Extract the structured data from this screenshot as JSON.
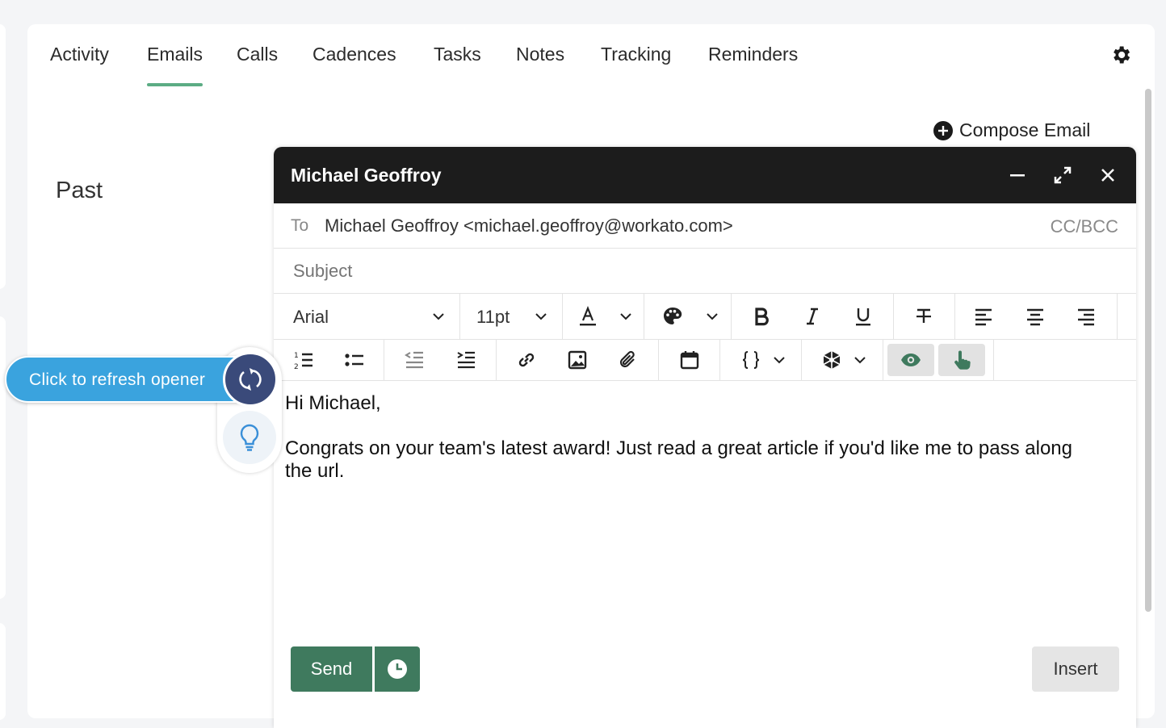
{
  "tabs": [
    {
      "label": "Activity"
    },
    {
      "label": "Emails"
    },
    {
      "label": "Calls"
    },
    {
      "label": "Cadences"
    },
    {
      "label": "Tasks"
    },
    {
      "label": "Notes"
    },
    {
      "label": "Tracking"
    },
    {
      "label": "Reminders"
    }
  ],
  "active_tab": "Emails",
  "compose_link": "Compose Email",
  "section_title": "Past",
  "compose": {
    "title": "Michael Geoffroy",
    "to_label": "To",
    "to_value": "Michael Geoffroy <michael.geoffroy@workato.com>",
    "cc_bcc": "CC/BCC",
    "subject_placeholder": "Subject",
    "font": "Arial",
    "font_size": "11pt",
    "body_line1": "Hi Michael,",
    "body_line2": "Congrats on your team's latest award! Just read a great article if you'd like me to pass along the url.",
    "send_label": "Send",
    "insert_label": "Insert"
  },
  "opener": {
    "label": "Click to refresh opener"
  },
  "colors": {
    "accent_green": "#5cac84",
    "send_green": "#3f7a5e",
    "header_dark": "#1c1c1c",
    "opener_blue": "#3aa3de",
    "opener_navy": "#3a4a7a"
  }
}
